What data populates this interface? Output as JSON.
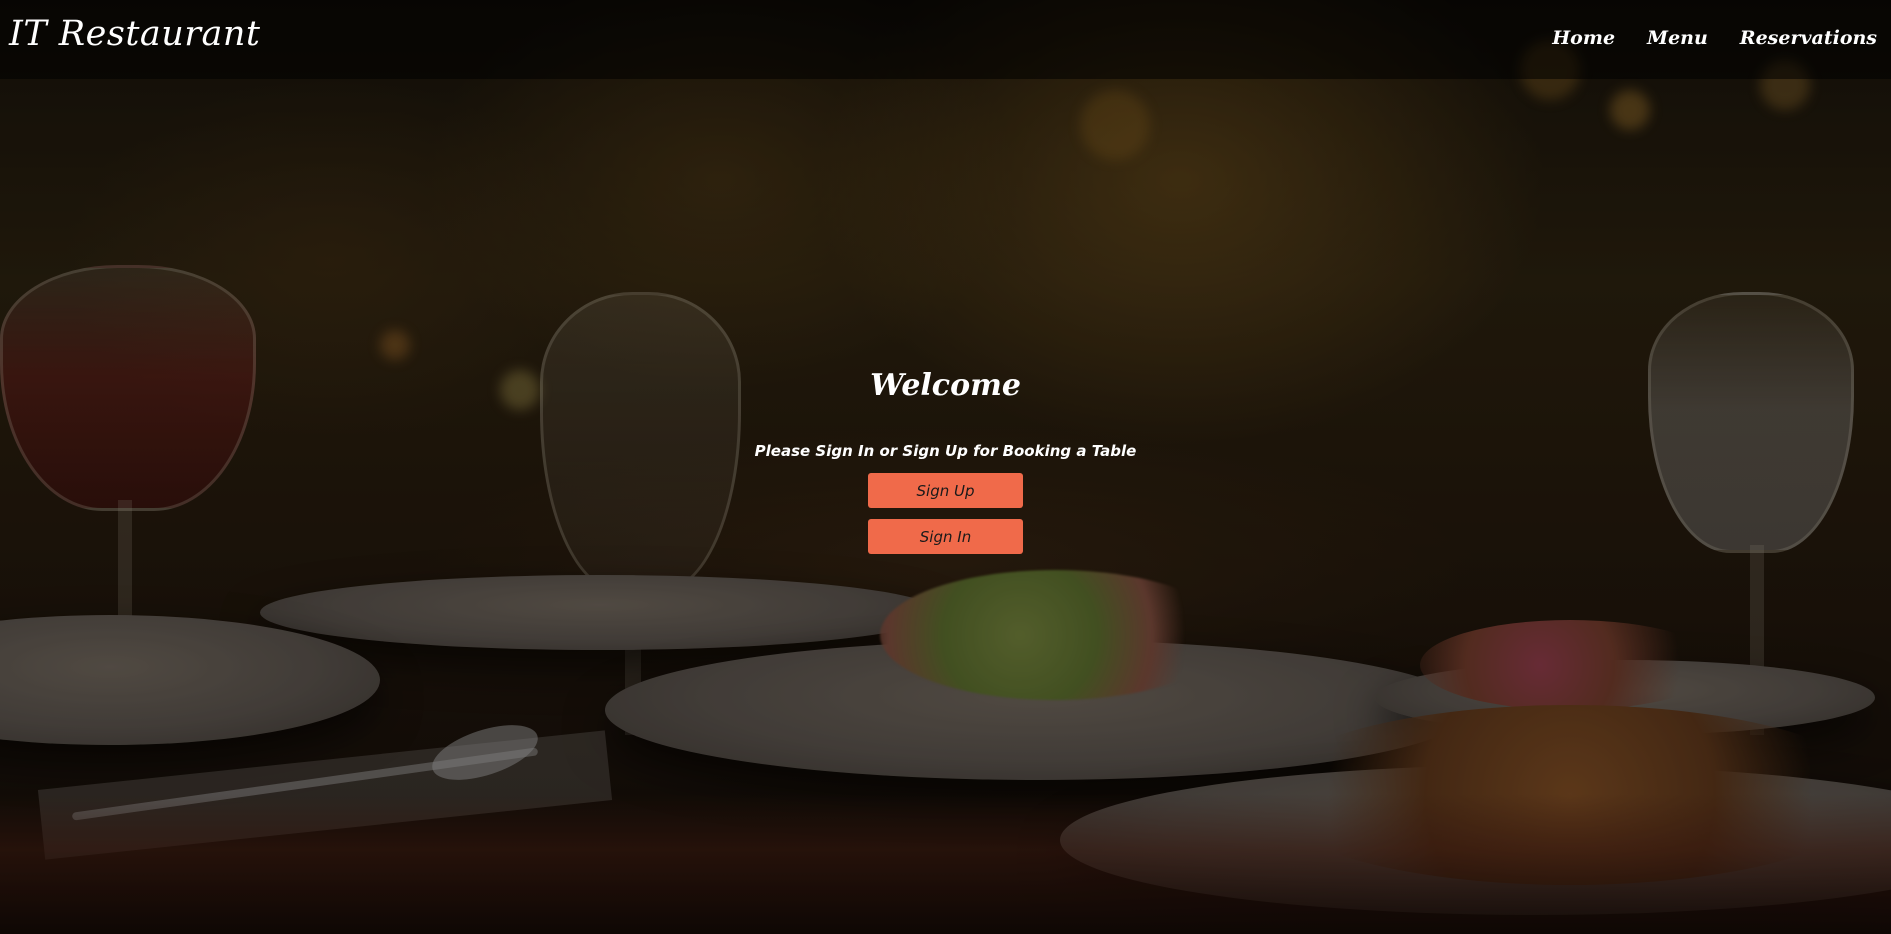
{
  "header": {
    "logo": "IT Restaurant",
    "nav": [
      {
        "label": "Home"
      },
      {
        "label": "Menu"
      },
      {
        "label": "Reservations"
      }
    ]
  },
  "main": {
    "title": "Welcome",
    "subtitle": "Please Sign In or Sign Up for Booking a Table",
    "signup_label": "Sign Up",
    "signin_label": "Sign In"
  },
  "colors": {
    "accent": "#f06a4a",
    "header_bg": "#000000",
    "text": "#ffffff"
  }
}
